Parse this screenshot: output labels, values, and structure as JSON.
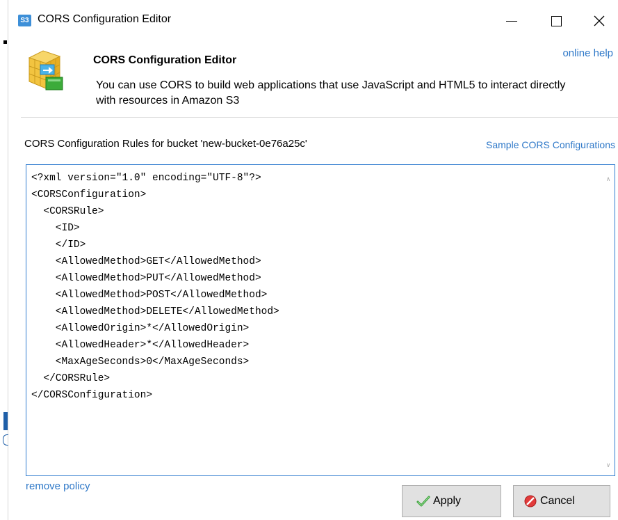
{
  "window": {
    "app_icon_text": "S3",
    "title": "CORS Configuration Editor"
  },
  "header": {
    "title": "CORS Configuration Editor",
    "description": "You can use CORS to build web applications that use JavaScript and HTML5 to interact directly with resources in Amazon S3",
    "help_link": "online help"
  },
  "rules": {
    "label": "CORS Configuration Rules for bucket 'new-bucket-0e76a25c'",
    "sample_link": "Sample CORS Configurations"
  },
  "editor": {
    "content": "<?xml version=\"1.0\" encoding=\"UTF-8\"?>\n<CORSConfiguration>\n  <CORSRule>\n    <ID>\n    </ID>\n    <AllowedMethod>GET</AllowedMethod>\n    <AllowedMethod>PUT</AllowedMethod>\n    <AllowedMethod>POST</AllowedMethod>\n    <AllowedMethod>DELETE</AllowedMethod>\n    <AllowedOrigin>*</AllowedOrigin>\n    <AllowedHeader>*</AllowedHeader>\n    <MaxAgeSeconds>0</MaxAgeSeconds>\n  </CORSRule>\n</CORSConfiguration>"
  },
  "footer": {
    "remove_link": "remove policy",
    "apply_label": "Apply",
    "cancel_label": "Cancel"
  },
  "icons": {
    "app": "s3-app-icon",
    "header": "cors-cube-icon",
    "apply": "checkmark-icon",
    "cancel": "no-entry-icon"
  },
  "colors": {
    "link": "#2e78c8",
    "editor_border": "#2e7bcf",
    "button_bg": "#e1e1e1"
  }
}
